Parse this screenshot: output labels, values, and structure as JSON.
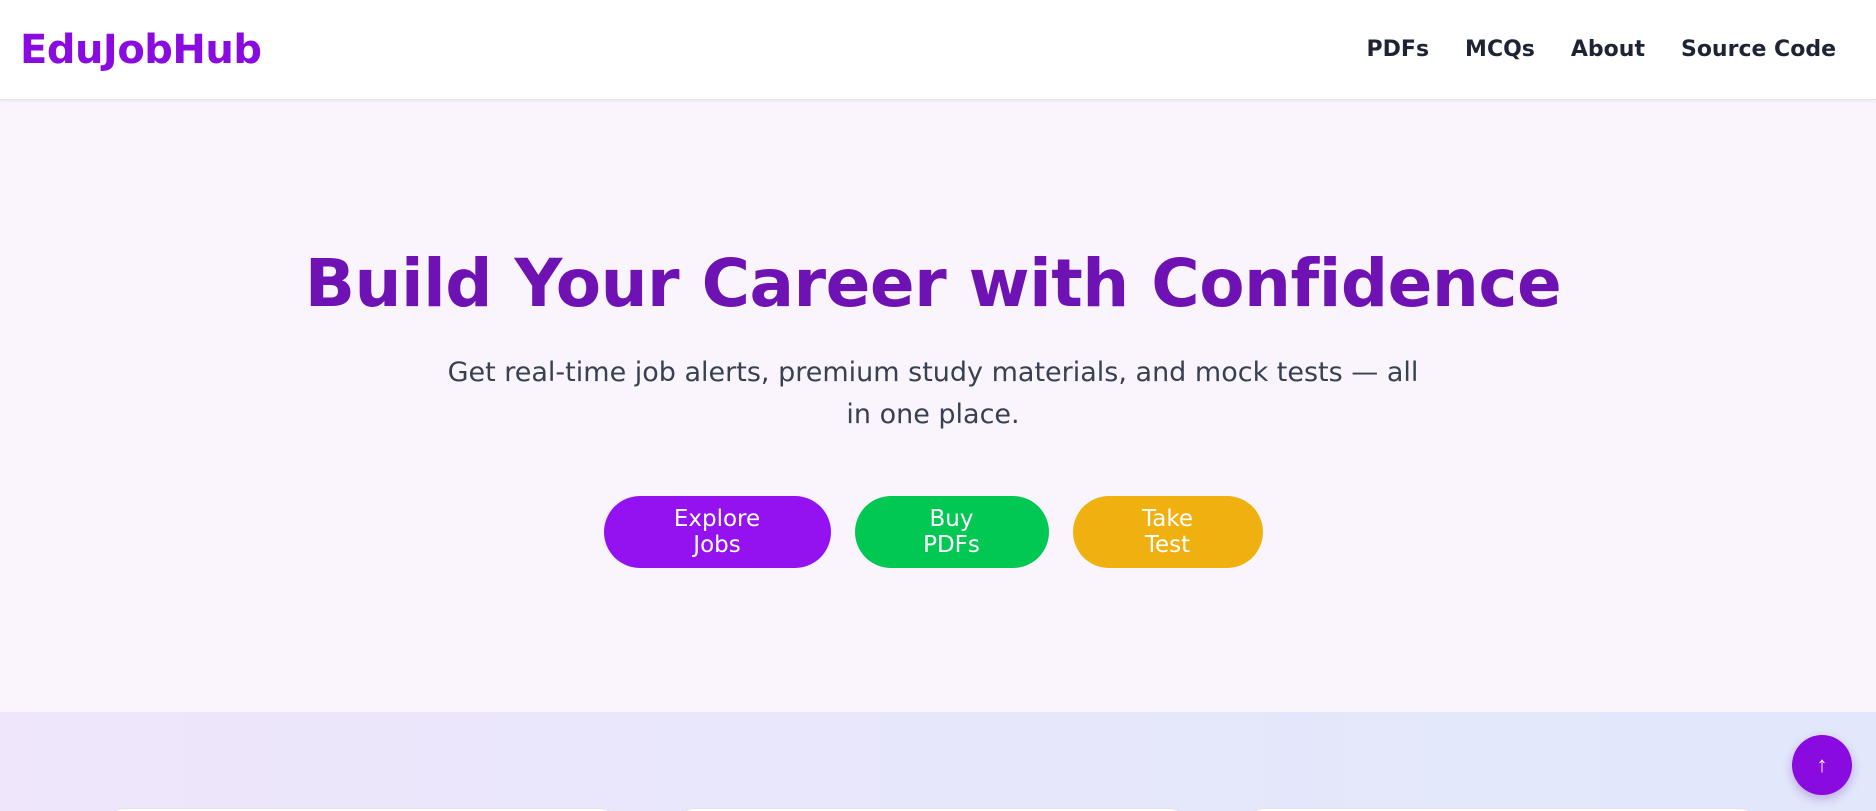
{
  "header": {
    "logo": "EduJobHub",
    "nav": [
      {
        "label": "PDFs"
      },
      {
        "label": "MCQs"
      },
      {
        "label": "About"
      },
      {
        "label": "Source Code"
      }
    ]
  },
  "hero": {
    "title": "Build Your Career with Confidence",
    "subtitle": "Get real-time job alerts, premium study materials, and mock tests — all in one place.",
    "buttons": {
      "explore_jobs": "Explore Jobs",
      "buy_pdfs": "Buy PDFs",
      "take_test": "Take Test"
    }
  },
  "scroll_top": {
    "icon": "arrow-up-icon",
    "glyph": "↑"
  },
  "colors": {
    "brand": "#8a0be0",
    "title": "#6e12b3",
    "explore": "#9411f0",
    "buy": "#00c853",
    "test": "#f0b010"
  }
}
